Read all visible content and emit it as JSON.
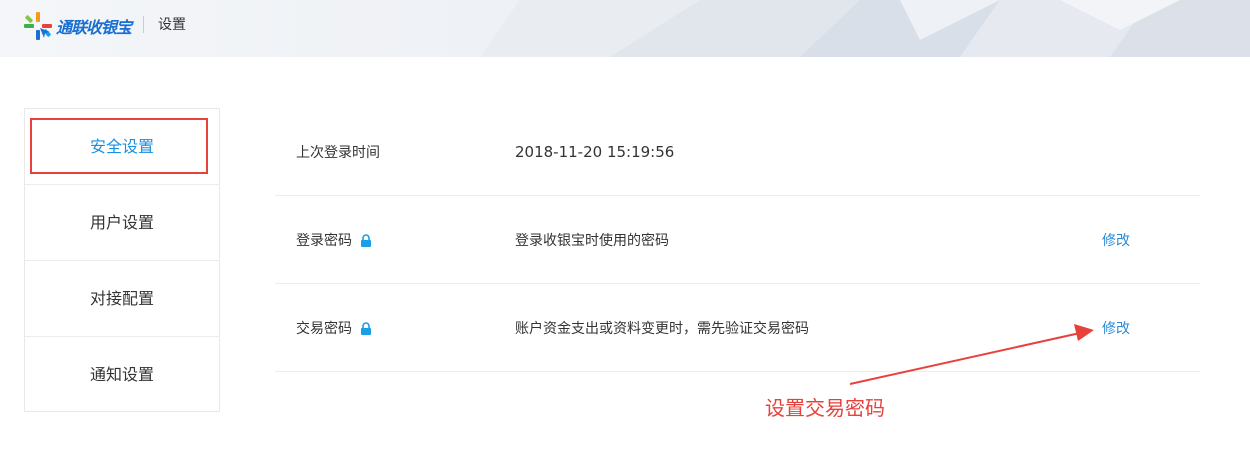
{
  "header": {
    "logo_text": "通联收银宝",
    "title": "设置"
  },
  "sidebar": {
    "items": [
      {
        "label": "安全设置",
        "active": true
      },
      {
        "label": "用户设置",
        "active": false
      },
      {
        "label": "对接配置",
        "active": false
      },
      {
        "label": "通知设置",
        "active": false
      }
    ]
  },
  "security": {
    "rows": [
      {
        "label": "上次登录时间",
        "value": "2018-11-20 15:19:56"
      },
      {
        "label": "登录密码",
        "value": "登录收银宝时使用的密码",
        "action": "修改",
        "icon": "lock-icon"
      },
      {
        "label": "交易密码",
        "value": "账户资金支出或资料变更时，需先验证交易密码",
        "action": "修改",
        "icon": "lock-icon"
      }
    ]
  },
  "annotation": {
    "text": "设置交易密码"
  },
  "colors": {
    "accent": "#1a8fe0",
    "link": "#2a8ad8",
    "annotation": "#e8413b",
    "lock": "#1a9ee8"
  }
}
